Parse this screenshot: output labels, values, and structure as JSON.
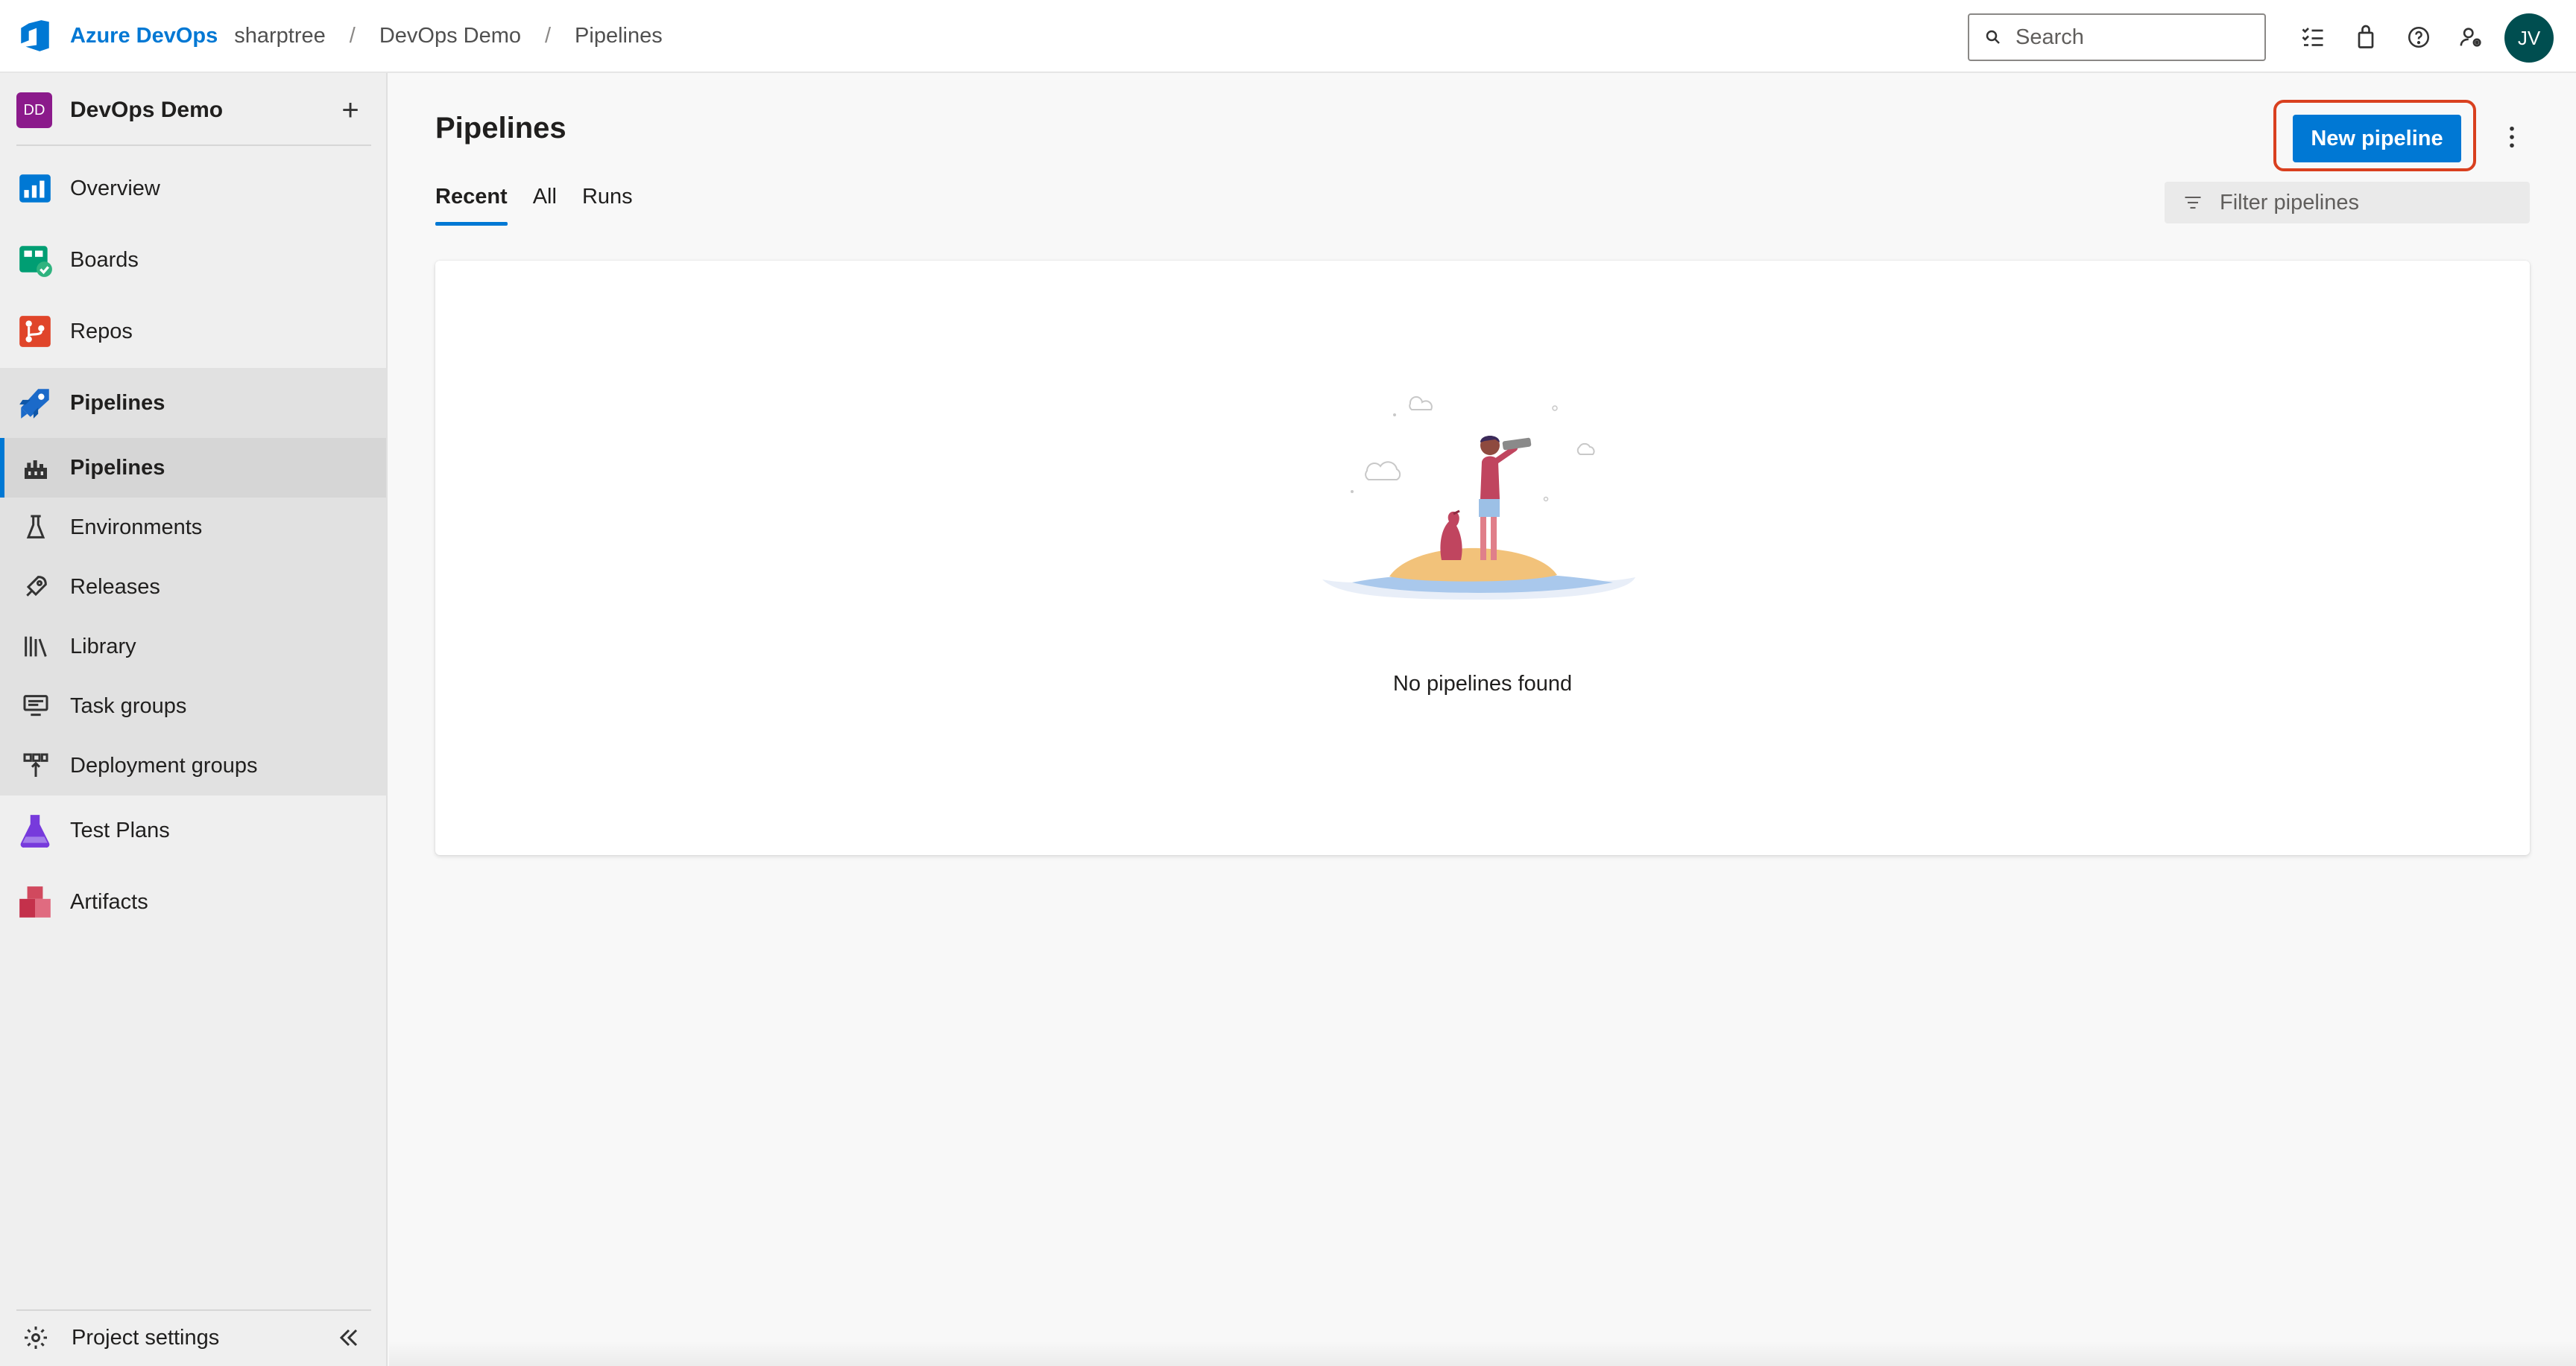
{
  "header": {
    "brand": "Azure DevOps",
    "breadcrumbs": [
      "sharptree",
      "DevOps Demo",
      "Pipelines"
    ],
    "separator": "/",
    "search_placeholder": "Search",
    "avatar_initials": "JV"
  },
  "sidebar": {
    "project_badge": "DD",
    "project_name": "DevOps Demo",
    "add_symbol": "+",
    "items": [
      {
        "label": "Overview",
        "icon": "overview-icon"
      },
      {
        "label": "Boards",
        "icon": "boards-icon"
      },
      {
        "label": "Repos",
        "icon": "repos-icon"
      },
      {
        "label": "Pipelines",
        "icon": "pipelines-icon"
      },
      {
        "label": "Test Plans",
        "icon": "test-plans-icon"
      },
      {
        "label": "Artifacts",
        "icon": "artifacts-icon"
      }
    ],
    "pipelines_subitems": [
      {
        "label": "Pipelines",
        "icon": "pipelines-sub-icon"
      },
      {
        "label": "Environments",
        "icon": "environments-icon"
      },
      {
        "label": "Releases",
        "icon": "releases-icon"
      },
      {
        "label": "Library",
        "icon": "library-icon"
      },
      {
        "label": "Task groups",
        "icon": "task-groups-icon"
      },
      {
        "label": "Deployment groups",
        "icon": "deployment-groups-icon"
      }
    ],
    "settings_label": "Project settings",
    "collapse_symbol": "«"
  },
  "main": {
    "title": "Pipelines",
    "new_button": "New pipeline",
    "tabs": [
      "Recent",
      "All",
      "Runs"
    ],
    "active_tab": "Recent",
    "filter_placeholder": "Filter pipelines",
    "empty_message": "No pipelines found"
  },
  "colors": {
    "accent": "#0078d4",
    "highlight_outline": "#d9401f",
    "project_badge": "#8b1a8b",
    "avatar_bg": "#004e50"
  }
}
